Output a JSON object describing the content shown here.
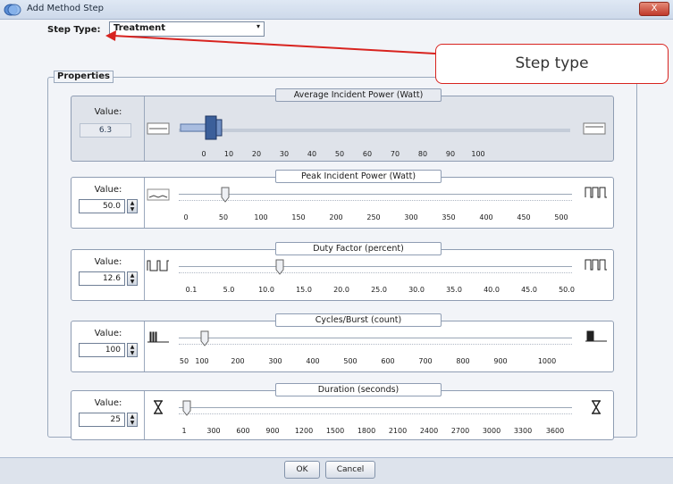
{
  "window": {
    "title": "Add Method Step",
    "close_label": "X"
  },
  "step_type": {
    "label": "Step Type:",
    "value": "Treatment",
    "dropdown_arrow": "▾"
  },
  "callout": {
    "text": "Step type"
  },
  "properties": {
    "label": "Properties"
  },
  "panels": [
    {
      "title": "Average Incident Power (Watt)",
      "value_label": "Value:",
      "value": "6.3",
      "disabled": true,
      "ticks": [
        "0",
        "10",
        "20",
        "30",
        "40",
        "50",
        "60",
        "70",
        "80",
        "90",
        "100"
      ],
      "level_fraction": 0.063
    },
    {
      "title": "Peak Incident Power (Watt)",
      "value_label": "Value:",
      "value": "50.0",
      "ticks": [
        "0",
        "50",
        "100",
        "150",
        "200",
        "250",
        "300",
        "350",
        "400",
        "450",
        "500"
      ],
      "level_fraction": 0.1
    },
    {
      "title": "Duty Factor (percent)",
      "value_label": "Value:",
      "value": "12.6",
      "ticks": [
        "0.1",
        "5.0",
        "10.0",
        "15.0",
        "20.0",
        "25.0",
        "30.0",
        "35.0",
        "40.0",
        "45.0",
        "50.0"
      ],
      "level_fraction": 0.25
    },
    {
      "title": "Cycles/Burst (count)",
      "value_label": "Value:",
      "value": "100",
      "ticks": [
        "50",
        "100",
        "200",
        "300",
        "400",
        "500",
        "600",
        "700",
        "800",
        "900",
        "1000"
      ],
      "level_fraction": 0.05
    },
    {
      "title": "Duration (seconds)",
      "value_label": "Value:",
      "value": "25",
      "ticks": [
        "1",
        "300",
        "600",
        "900",
        "1200",
        "1500",
        "1800",
        "2100",
        "2400",
        "2700",
        "3000",
        "3300",
        "3600"
      ],
      "level_fraction": 0.007
    }
  ],
  "buttons": {
    "ok": "OK",
    "cancel": "Cancel"
  },
  "colors": {
    "callout_border": "#d8231f",
    "arrow": "#d8231f",
    "thumb_active": "#3b5f9a"
  }
}
